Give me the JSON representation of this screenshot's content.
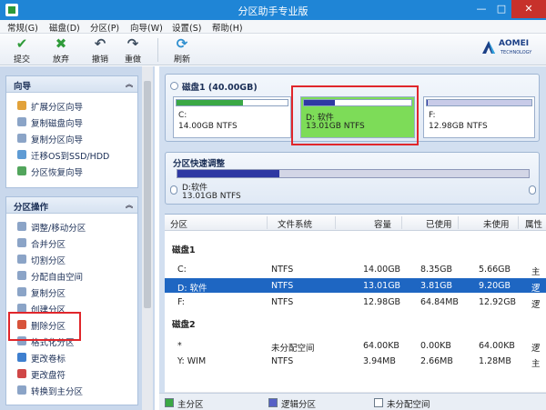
{
  "window": {
    "title": "分区助手专业版",
    "min": "—",
    "max": "□",
    "close": "✕"
  },
  "menu": [
    "常规(G)",
    "磁盘(D)",
    "分区(P)",
    "向导(W)",
    "设置(S)",
    "帮助(H)"
  ],
  "toolbar": [
    {
      "label": "提交",
      "icon": "check-icon",
      "color": "#2f9b3a",
      "glyph": "✔"
    },
    {
      "label": "放弃",
      "icon": "discard-icon",
      "color": "#2f9b3a",
      "glyph": "✖"
    },
    {
      "label": "撤销",
      "icon": "undo-icon",
      "color": "#3d4d5f",
      "glyph": "↶"
    },
    {
      "label": "重做",
      "icon": "redo-icon",
      "color": "#3d4d5f",
      "glyph": "↷"
    },
    {
      "label": "刷新",
      "icon": "refresh-icon",
      "color": "#2f8fcf",
      "glyph": "⟳"
    }
  ],
  "logo": {
    "name": "AOMEI",
    "sub": "TECHNOLOGY"
  },
  "sidebar": {
    "wizard": {
      "title": "向导",
      "collapse": "︽",
      "items": [
        "扩展分区向导",
        "复制磁盘向导",
        "复制分区向导",
        "迁移OS到SSD/HDD",
        "分区恢复向导"
      ]
    },
    "ops": {
      "title": "分区操作",
      "collapse": "︽",
      "items": [
        "调整/移动分区",
        "合并分区",
        "切割分区",
        "分配自由空间",
        "复制分区",
        "创建分区",
        "删除分区",
        "格式化分区",
        "更改卷标",
        "更改盘符",
        "转换到主分区"
      ]
    }
  },
  "disk": {
    "title": "磁盘1 (40.00GB)",
    "partitions": [
      {
        "name": "C:",
        "size": "14.00GB NTFS",
        "used_fraction": 0.6,
        "color": "#3aa845"
      },
      {
        "name": "D: 软件",
        "size": "13.01GB NTFS",
        "used_fraction": 0.29,
        "color": "#2e38a3"
      },
      {
        "name": "F:",
        "size": "12.98GB NTFS",
        "used_fraction": 0.005,
        "color": "#2e38a3"
      }
    ]
  },
  "quick": {
    "title": "分区快速调整",
    "name": "D:软件",
    "size": "13.01GB NTFS",
    "used_fraction": 0.29
  },
  "table": {
    "headers": [
      "分区",
      "文件系统",
      "容量",
      "已使用",
      "未使用",
      "属性"
    ],
    "groups": [
      {
        "name": "磁盘1",
        "rows": [
          {
            "part": "C:",
            "fs": "NTFS",
            "cap": "14.00GB",
            "used": "8.35GB",
            "free": "5.66GB",
            "attr": "主"
          },
          {
            "part": "D: 软件",
            "fs": "NTFS",
            "cap": "13.01GB",
            "used": "3.81GB",
            "free": "9.20GB",
            "attr": "逻"
          },
          {
            "part": "F:",
            "fs": "NTFS",
            "cap": "12.98GB",
            "used": "64.84MB",
            "free": "12.92GB",
            "attr": "逻"
          }
        ]
      },
      {
        "name": "磁盘2",
        "rows": [
          {
            "part": "*",
            "fs": "未分配空间",
            "cap": "64.00KB",
            "used": "0.00KB",
            "free": "64.00KB",
            "attr": "逻"
          },
          {
            "part": "Y: WIM",
            "fs": "NTFS",
            "cap": "3.94MB",
            "used": "2.66MB",
            "free": "1.28MB",
            "attr": "主"
          }
        ]
      }
    ]
  },
  "legend": [
    {
      "label": "主分区",
      "color": "#3aa845"
    },
    {
      "label": "逻辑分区",
      "color": "#5560c6"
    },
    {
      "label": "未分配空间",
      "color": "#ffffff"
    }
  ]
}
